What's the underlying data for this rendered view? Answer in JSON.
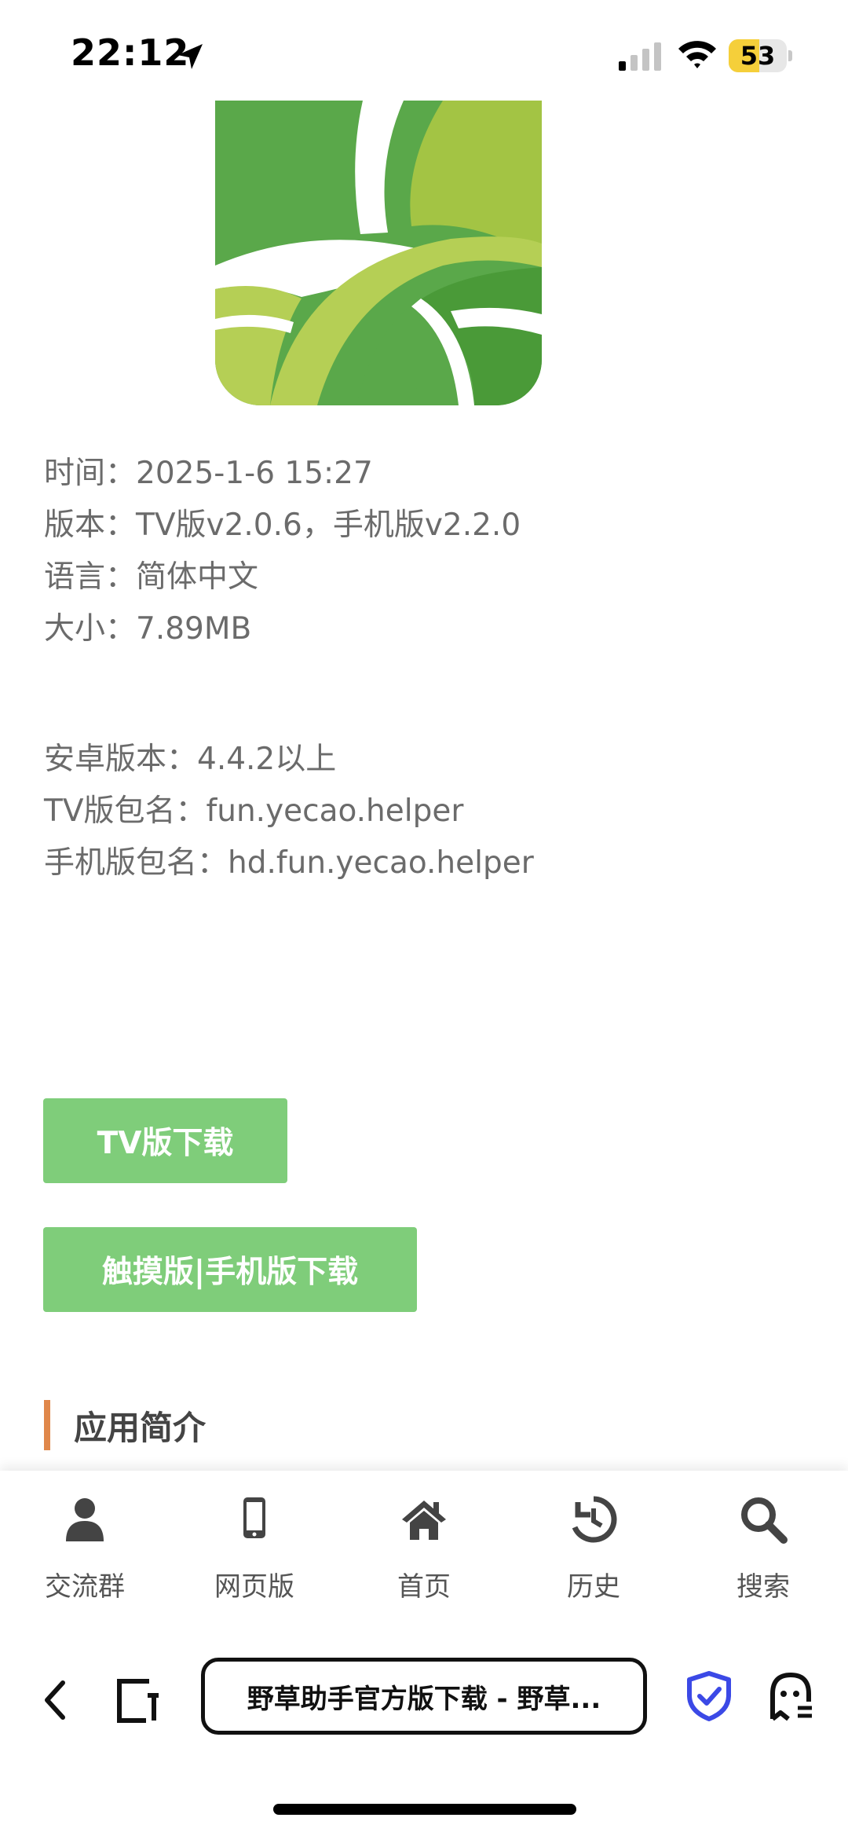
{
  "status_bar": {
    "time": "22:12",
    "battery_level": "53",
    "battery_fraction": 0.53,
    "icons": [
      "location-arrow-icon",
      "cellular-signal-icon",
      "wifi-icon",
      "battery-icon"
    ]
  },
  "app_info": {
    "time_line": "时间：2025-1-6 15:27",
    "version_line": "版本：TV版v2.0.6，手机版v2.2.0",
    "language_line": "语言：简体中文",
    "size_line": "大小：7.89MB",
    "android_line": "安卓版本：4.4.2以上",
    "tv_package_line": "TV版包名：fun.yecao.helper",
    "mobile_package_line": "手机版包名：hd.fun.yecao.helper"
  },
  "downloads": {
    "tv_label": "TV版下载",
    "mobile_label": "触摸版|手机版下载"
  },
  "section": {
    "title": "应用简介"
  },
  "site_nav": {
    "items": [
      {
        "label": "交流群",
        "icon": "user-icon"
      },
      {
        "label": "网页版",
        "icon": "mobile-phone-icon"
      },
      {
        "label": "首页",
        "icon": "home-icon"
      },
      {
        "label": "历史",
        "icon": "history-icon"
      },
      {
        "label": "搜索",
        "icon": "search-icon"
      }
    ]
  },
  "browser": {
    "page_title": "野草助手官方版下载 - 野草...",
    "icons": [
      "back-arrow-icon",
      "tabs-icon",
      "shield-check-icon",
      "ghost-privacy-icon"
    ]
  },
  "colors": {
    "button_green": "#7fcd7a",
    "section_accent": "#e0874a",
    "shield_blue": "#3b49e6",
    "battery_yellow": "#f5cf3a"
  }
}
